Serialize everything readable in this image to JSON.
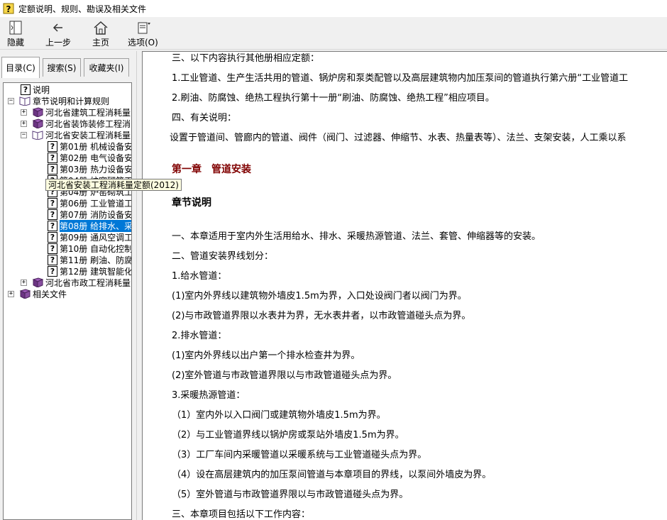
{
  "window": {
    "title": "定额说明、规则、勘误及相关文件"
  },
  "toolbar": {
    "hide": "隐藏",
    "back": "上一步",
    "home": "主页",
    "options": "选项(O)"
  },
  "tabs": {
    "contents": "目录(C)",
    "search": "搜索(S)",
    "favorites": "收藏夹(I)"
  },
  "tree": {
    "n0": "说明",
    "n1": "章节说明和计算规则",
    "n2": "河北省建筑工程消耗量",
    "n3": "河北省装饰装修工程消",
    "n4": "河北省安装工程消耗量",
    "children": [
      "第01册 机械设备安",
      "第02册 电气设备安",
      "第03册 热力设备安",
      "第04册 炉窑砌筑工",
      "第04册 炉窑砌筑工",
      "第06册 工业管道工",
      "第07册 消防设备安",
      "第08册 给排水、采",
      "第09册 通风空调工",
      "第10册 自动化控制",
      "第11册 刷油、防腐",
      "第12册 建筑智能化"
    ],
    "n5": "河北省市政工程消耗量",
    "n6": "相关文件"
  },
  "tooltip": "河北省安装工程消耗量定额(2012)",
  "content": {
    "lines": [
      "三、以下内容执行其他册相应定额：",
      "1.工业管道、生产生活共用的管道、锅炉房和泵类配管以及高层建筑物内加压泵间的管道执行第六册“工业管道工",
      "2.刷油、防腐蚀、绝热工程执行第十一册“刷油、防腐蚀、绝热工程”相应项目。",
      "四、有关说明：",
      "设置于管道间、管廊内的管道、阀件（阀门、过滤器、伸缩节、水表、热量表等）、法兰、支架安装，人工乘以系"
    ],
    "chapter_title": "第一章　管道安装",
    "section_title": "章节说明",
    "body": [
      "一、本章适用于室内外生活用给水、排水、采暖热源管道、法兰、套管、伸缩器等的安装。",
      "二、管道安装界线划分：",
      "1.给水管道：",
      "(1)室内外界线以建筑物外墙皮1.5m为界，入口处设阀门者以阀门为界。",
      "(2)与市政管道界限以水表井为界，无水表井者，以市政管道碰头点为界。",
      "2.排水管道：",
      "(1)室内外界线以出户第一个排水检查井为界。",
      "(2)室外管道与市政管道界限以与市政管道碰头点为界。",
      "3.采暖热源管道：",
      "（1）室内外以入口阀门或建筑物外墙皮1.5m为界。",
      "（2）与工业管道界线以锅炉房或泵站外墙皮1.5m为界。",
      "（3）工厂车间内采暖管道以采暖系统与工业管道碰头点为界。",
      "（4）设在高层建筑内的加压泵间管道与本章项目的界线，以泵间外墙皮为界。",
      "（5）室外管道与市政管道界限以与市政管道碰头点为界。",
      "三、本章项目包括以下工作内容："
    ]
  }
}
